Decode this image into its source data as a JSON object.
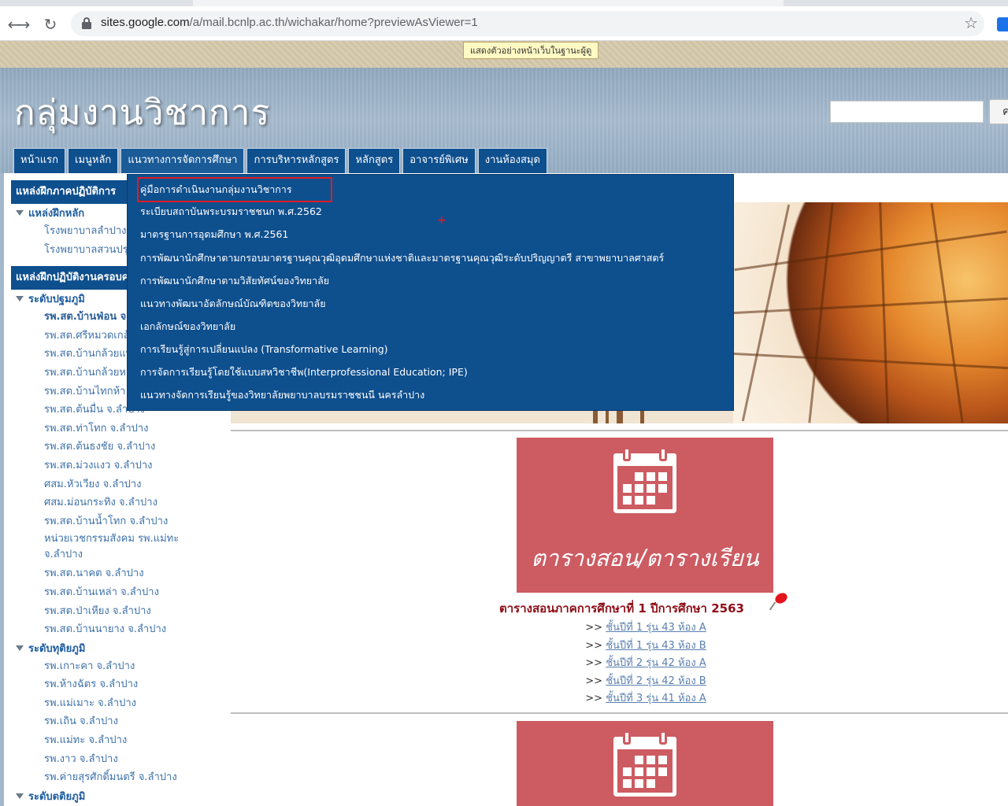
{
  "browser": {
    "url_host": "sites.google.com",
    "url_path": "/a/mail.bcnlp.ac.th/wichakar/home?previewAsViewer=1",
    "back_icon": "arrow-left",
    "forward_icon": "arrow-right",
    "reload_icon": "reload"
  },
  "preview_banner": "แสดงตัวอย่างหน้าเว็บในฐานะผู้ดู",
  "site": {
    "title": "กลุ่มงานวิชาการ",
    "search_button": "ค"
  },
  "nav": {
    "tabs": [
      {
        "label": "หน้าแรก"
      },
      {
        "label": "เมนูหลัก"
      },
      {
        "label": "แนวทางการจัดการศึกษา"
      },
      {
        "label": "การบริหารหลักสูตร"
      },
      {
        "label": "หลักสูตร"
      },
      {
        "label": "อาจารย์พิเศษ"
      },
      {
        "label": "งานห้องสมุด"
      }
    ]
  },
  "dropdown": {
    "items": [
      {
        "label": "คู่มือการดำเนินงานกลุ่มงานวิชาการ"
      },
      {
        "label": "ระเบียบสถาบันพระบรมราชชนก พ.ศ.2562"
      },
      {
        "label": "มาตรฐานการอุดมศึกษา พ.ศ.2561"
      },
      {
        "label": "การพัฒนานักศึกษาตามกรอบมาตรฐานคุณวุฒิอุดมศึกษาแห่งชาติและมาตรฐานคุณวุฒิระดับปริญญาตรี สาขาพยาบาลศาสตร์"
      },
      {
        "label": "การพัฒนานักศึกษาตามวิสัยทัศน์ของวิทยาลัย"
      },
      {
        "label": "แนวทางพัฒนาอัตลักษณ์บัณฑิตของวิทยาลัย"
      },
      {
        "label": "เอกลักษณ์ของวิทยาลัย"
      },
      {
        "label": "การเรียนรู้สู่การเปลี่ยนแปลง (Transformative Learning)"
      },
      {
        "label": "การจัดการเรียนรู้โดยใช้แบบสหวิชาชีพ(Interprofessional Education; IPE)"
      },
      {
        "label": "แนวทางจัดการเรียนรู้ของวิทยาลัยพยาบาลบรมราชชนนี นครลำปาง"
      }
    ]
  },
  "sidebar": {
    "section1": {
      "heading": "แหล่งฝึกภาคปฏิบัติการ",
      "group": "แหล่งฝึกหลัก",
      "items": [
        "โรงพยาบาลลำปาง",
        "โรงพยาบาลสวนปรุง"
      ]
    },
    "section2": {
      "heading": "แหล่งฝึกปฏิบัติงานครอบครัว",
      "group_primary": "ระดับปฐมภูมิ",
      "primary_items": [
        "รพ.สต.บ้านฟ่อน จ.ลำปาง",
        "รพ.สต.ศรีหมวดเกล้า จ.ลำปาง",
        "รพ.สต.บ้านกล้วยแพะ จ.ลำปาง",
        "รพ.สต.บ้านกล้วยหลวง จ.ลำปาง",
        "รพ.สต.บ้านไทกห้า จ.ลำปาง",
        "รพ.สต.ต้นมื่น จ.ลำปาง",
        "รพ.สต.ท่าโทก จ.ลำปาง",
        "รพ.สต.ต้นธงชัย จ.ลำปาง",
        "รพ.สต.ม่วงแงว จ.ลำปาง",
        "ศสม.หัวเวียง จ.ลำปาง",
        "ศสม.ม่อนกระทิง จ.ลำปาง",
        "รพ.สต.บ้านน้ำโทก จ.ลำปาง",
        "หน่วยเวชกรรมสังคม รพ.แม่ทะ จ.ลำปาง",
        "รพ.สต.นาคต จ.ลำปาง",
        "รพ.สต.บ้านเหล่า จ.ลำปาง",
        "รพ.สต.ป่าเหียง จ.ลำปาง",
        "รพ.สต.บ้านนายาง จ.ลำปาง"
      ],
      "group_secondary": "ระดับทุติยภูมิ",
      "secondary_items": [
        "รพ.เกาะคา จ.ลำปาง",
        "รพ.ห้างฉัตร จ.ลำปาง",
        "รพ.แม่เมาะ จ.ลำปาง",
        "รพ.เถิน จ.ลำปาง",
        "รพ.แม่ทะ จ.ลำปาง",
        "รพ.งาว จ.ลำปาง",
        "รพ.ค่ายสุรศักดิ์มนตรี จ.ลำปาง"
      ],
      "group_tertiary": "ระดับตติยภูมิ"
    }
  },
  "main": {
    "calendar_caption": "ตารางสอน/ตารางเรียน",
    "schedule_title": "ตารางสอนภาคการศึกษาที่ 1 ปีการศึกษา 2563",
    "link_prefix": ">>",
    "links": [
      "ชั้นปีที่ 1 รุ่น 43 ห้อง A",
      "ชั้นปีที่ 1 รุ่น 43 ห้อง B",
      "ชั้นปีที่ 2 รุ่น 42 ห้อง A",
      "ชั้นปีที่ 2 รุ่น 42 ห้อง B",
      "ชั้นปีที่ 3 รุ่น 41 ห้อง A"
    ]
  },
  "colors": {
    "nav_blue": "#0e4f8e",
    "calendar_red": "#cd5b62",
    "schedule_title": "#8e0d16",
    "highlight_red": "#e11b22"
  }
}
